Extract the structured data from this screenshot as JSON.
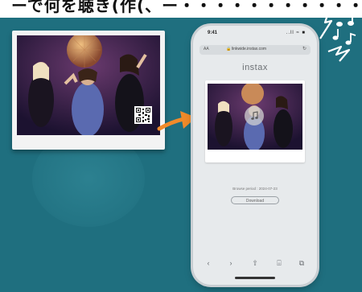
{
  "caption": "ーで何を聴き(作(、ー・・・・・・・・・・・",
  "print": {
    "qr_label": "QR code"
  },
  "phone": {
    "status": {
      "time": "9:41",
      "icons": "..ll ≈ ■"
    },
    "url_bar": {
      "aa": "AA",
      "url": "linkwide.instax.com",
      "lock": "🔒",
      "reload": "↻"
    },
    "brand": "instax",
    "browse_period": "Browse period : 2024-07-23",
    "download_label": "Download",
    "toolbar": {
      "back": "‹",
      "forward": "›",
      "share": "⇧",
      "bookmarks": "⌹",
      "tabs": "⧉"
    }
  },
  "colors": {
    "background": "#1f6f7f",
    "arrow": "#f08a2a",
    "notes": "#ffffff",
    "phone_body": "#e7eaec"
  }
}
